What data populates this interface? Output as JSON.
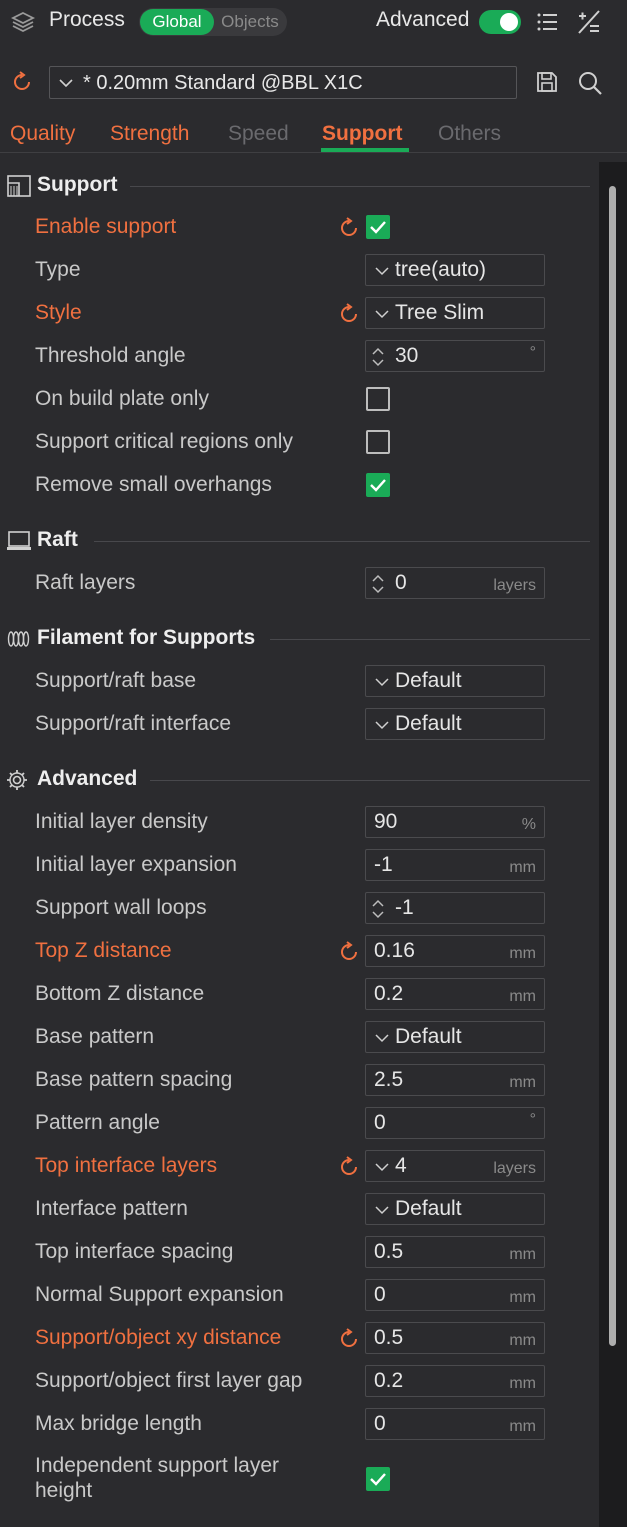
{
  "header": {
    "title": "Process",
    "scope_global": "Global",
    "scope_objects": "Objects",
    "advanced_label": "Advanced",
    "advanced_on": true
  },
  "preset": {
    "name": "* 0.20mm Standard @BBL X1C"
  },
  "tabs": [
    {
      "label": "Quality",
      "state": "modified"
    },
    {
      "label": "Strength",
      "state": "modified"
    },
    {
      "label": "Speed",
      "state": "normal"
    },
    {
      "label": "Support",
      "state": "active"
    },
    {
      "label": "Others",
      "state": "normal"
    }
  ],
  "sections": {
    "support": {
      "title": "Support",
      "rows": [
        {
          "label": "Enable support",
          "value": "",
          "checked": true,
          "modified": true
        },
        {
          "label": "Type",
          "value": "tree(auto)"
        },
        {
          "label": "Style",
          "value": "Tree Slim",
          "modified": true
        },
        {
          "label": "Threshold angle",
          "value": "30",
          "unit": "°"
        },
        {
          "label": "On build plate only",
          "checked": false
        },
        {
          "label": "Support critical regions only",
          "checked": false
        },
        {
          "label": "Remove small overhangs",
          "checked": true
        }
      ]
    },
    "raft": {
      "title": "Raft",
      "rows": [
        {
          "label": "Raft layers",
          "value": "0",
          "unit": "layers"
        }
      ]
    },
    "filament": {
      "title": "Filament for Supports",
      "rows": [
        {
          "label": "Support/raft base",
          "value": "Default"
        },
        {
          "label": "Support/raft interface",
          "value": "Default"
        }
      ]
    },
    "advanced": {
      "title": "Advanced",
      "rows": [
        {
          "label": "Initial layer density",
          "value": "90",
          "unit": "%"
        },
        {
          "label": "Initial layer expansion",
          "value": "-1",
          "unit": "mm"
        },
        {
          "label": "Support wall loops",
          "value": "-1"
        },
        {
          "label": "Top Z distance",
          "value": "0.16",
          "unit": "mm",
          "modified": true
        },
        {
          "label": "Bottom Z distance",
          "value": "0.2",
          "unit": "mm"
        },
        {
          "label": "Base pattern",
          "value": "Default"
        },
        {
          "label": "Base pattern spacing",
          "value": "2.5",
          "unit": "mm"
        },
        {
          "label": "Pattern angle",
          "value": "0",
          "unit": "°"
        },
        {
          "label": "Top interface layers",
          "value": "4",
          "unit": "layers",
          "modified": true
        },
        {
          "label": "Interface pattern",
          "value": "Default"
        },
        {
          "label": "Top interface spacing",
          "value": "0.5",
          "unit": "mm"
        },
        {
          "label": "Normal Support expansion",
          "value": "0",
          "unit": "mm"
        },
        {
          "label": "Support/object xy distance",
          "value": "0.5",
          "unit": "mm",
          "modified": true
        },
        {
          "label": "Support/object first layer gap",
          "value": "0.2",
          "unit": "mm"
        },
        {
          "label": "Max bridge length",
          "value": "0",
          "unit": "mm"
        },
        {
          "label": "Independent support layer",
          "label_line2": "height",
          "checked": true
        }
      ]
    }
  },
  "colors": {
    "accent_green": "#1aab57",
    "modified_orange": "#f07040",
    "background": "#2b2b2e"
  },
  "icons": {
    "header": [
      "layers-icon",
      "list-icon",
      "compare-icon"
    ],
    "preset": [
      "reset-icon",
      "chevron-down-icon",
      "save-icon",
      "search-icon"
    ],
    "sections": [
      "support-icon",
      "raft-icon",
      "filament-icon",
      "gear-icon"
    ]
  }
}
